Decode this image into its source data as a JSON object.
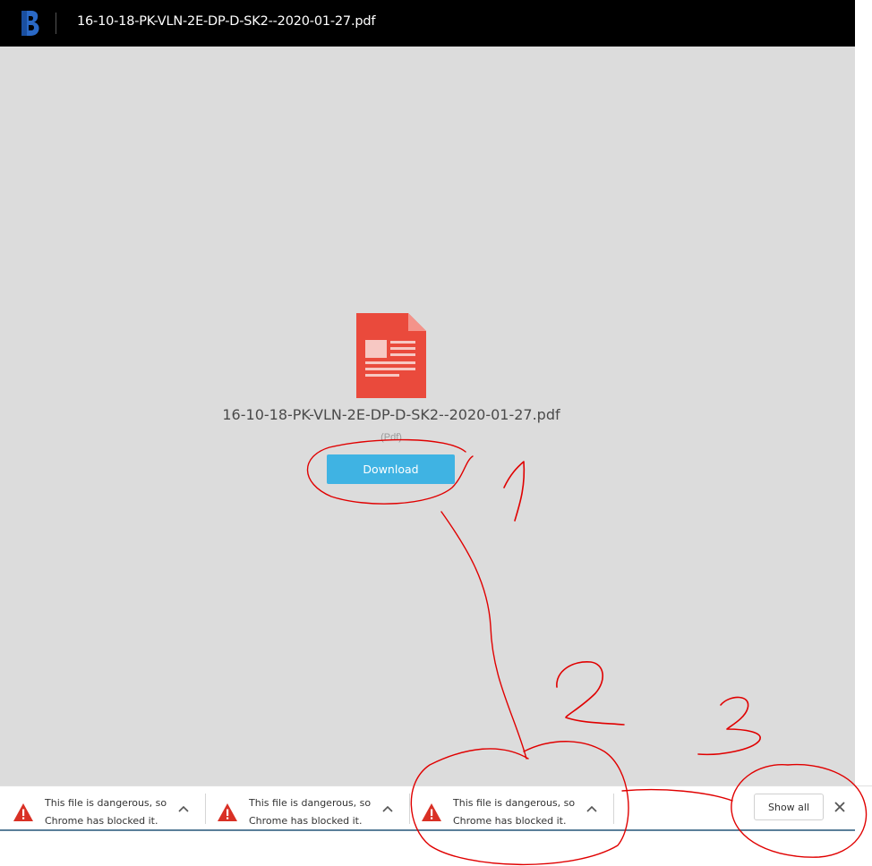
{
  "header": {
    "logo_letter": "B",
    "title": "16-10-18-PK-VLN-2E-DP-D-SK2--2020-01-27.pdf"
  },
  "viewer": {
    "file_icon": "pdf-document-icon",
    "file_name": "16-10-18-PK-VLN-2E-DP-D-SK2--2020-01-27.pdf",
    "file_type": "(Pdf)",
    "download_label": "Download"
  },
  "shelf": {
    "items": [
      {
        "line1": "This file is dangerous, so",
        "line2": "Chrome has blocked it.",
        "icon": "warning-icon"
      },
      {
        "line1": "This file is dangerous, so",
        "line2": "Chrome has blocked it.",
        "icon": "warning-icon"
      },
      {
        "line1": "This file is dangerous, so",
        "line2": "Chrome has blocked it.",
        "icon": "warning-icon"
      }
    ],
    "show_all_label": "Show all",
    "close_icon": "close-icon"
  },
  "annotations": {
    "marks": [
      "1",
      "2",
      "3"
    ],
    "color": "#e00000"
  },
  "colors": {
    "accent": "#3fb3e3",
    "pdf_red": "#ea4a3c",
    "warning_red": "#d93025"
  }
}
